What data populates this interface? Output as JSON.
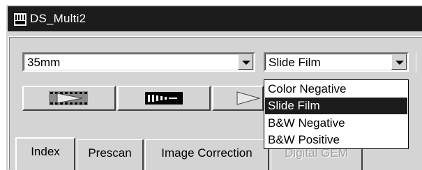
{
  "window": {
    "title": "DS_Multi2"
  },
  "film_size": {
    "selected": "35mm"
  },
  "film_type": {
    "selected": "Slide Film",
    "options": [
      "Color Negative",
      "Slide Film",
      "B&W Negative",
      "B&W Positive"
    ]
  },
  "toolbar": {
    "buttons": [
      {
        "icon": "film-strip-play-icon"
      },
      {
        "icon": "film-index-icon"
      },
      {
        "icon": "play-icon"
      }
    ]
  },
  "tabs": [
    {
      "label": "Index",
      "active": true
    },
    {
      "label": "Prescan"
    },
    {
      "label": "Image Correction"
    },
    {
      "label": "Digital GEM",
      "disabled": true
    }
  ],
  "colors": {
    "titlebar": "#1c1c1c",
    "face": "#d4d4d4",
    "selection": "#1c1c1c"
  }
}
